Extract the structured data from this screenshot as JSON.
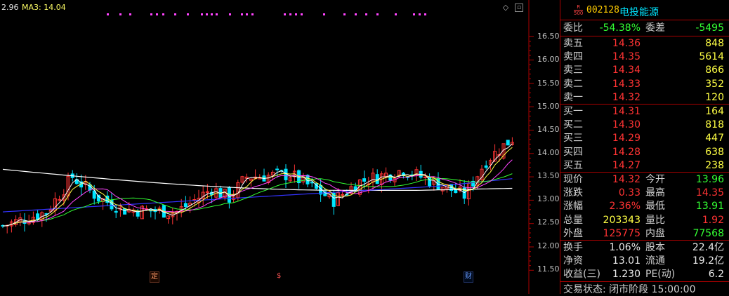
{
  "header": {
    "first_value": "2.96",
    "ma3_label": "MA3: 14.04"
  },
  "price_axis": [
    "16.50",
    "16.00",
    "15.50",
    "15.00",
    "14.50",
    "14.00",
    "13.50",
    "13.00",
    "12.50",
    "12.00",
    "11.50"
  ],
  "events": [
    {
      "label": "定",
      "style": "orange"
    },
    {
      "label": "$",
      "style": "red"
    },
    {
      "label": "财",
      "style": "blue"
    }
  ],
  "colors": {
    "up": "#ff3333",
    "down": "#00e5ff",
    "ma_white": "#ffffff",
    "ma_yellow": "#ffff44",
    "ma_magenta": "#ff44ff",
    "ma_green": "#33ff33",
    "ma_blue": "#3333ff",
    "signal_dots": "#ff44ff"
  },
  "quote": {
    "badge_top": "R",
    "badge_bottom": "500",
    "code": "002128",
    "name": "电投能源",
    "weibi_label": "委比",
    "weibi_value": "-54.38%",
    "weicha_label": "委差",
    "weicha_value": "-5495",
    "sells": [
      {
        "label": "卖五",
        "price": "14.36",
        "vol": "848"
      },
      {
        "label": "卖四",
        "price": "14.35",
        "vol": "5614"
      },
      {
        "label": "卖三",
        "price": "14.34",
        "vol": "866"
      },
      {
        "label": "卖二",
        "price": "14.33",
        "vol": "352"
      },
      {
        "label": "卖一",
        "price": "14.32",
        "vol": "120"
      }
    ],
    "buys": [
      {
        "label": "买一",
        "price": "14.31",
        "vol": "164"
      },
      {
        "label": "买二",
        "price": "14.30",
        "vol": "818"
      },
      {
        "label": "买三",
        "price": "14.29",
        "vol": "447"
      },
      {
        "label": "买四",
        "price": "14.28",
        "vol": "638"
      },
      {
        "label": "买五",
        "price": "14.27",
        "vol": "238"
      }
    ],
    "stats1": [
      {
        "l1": "现价",
        "v1": "14.32",
        "c1": "red",
        "l2": "今开",
        "v2": "13.96",
        "c2": "green"
      },
      {
        "l1": "涨跌",
        "v1": "0.33",
        "c1": "red",
        "l2": "最高",
        "v2": "14.35",
        "c2": "red"
      },
      {
        "l1": "涨幅",
        "v1": "2.36%",
        "c1": "red",
        "l2": "最低",
        "v2": "13.91",
        "c2": "green"
      },
      {
        "l1": "总量",
        "v1": "203343",
        "c1": "yellow",
        "l2": "量比",
        "v2": "1.92",
        "c2": "red"
      },
      {
        "l1": "外盘",
        "v1": "125775",
        "c1": "red",
        "l2": "内盘",
        "v2": "77568",
        "c2": "green"
      }
    ],
    "stats2": [
      {
        "l1": "换手",
        "v1": "1.06%",
        "l2": "股本",
        "v2": "22.4亿"
      },
      {
        "l1": "净资",
        "v1": "13.01",
        "l2": "流通",
        "v2": "19.2亿"
      },
      {
        "l1": "收益(三)",
        "v1": "1.230",
        "l2": "PE(动)",
        "v2": "6.2"
      }
    ],
    "status": "交易状态: 闭市阶段 15:00:00"
  }
}
